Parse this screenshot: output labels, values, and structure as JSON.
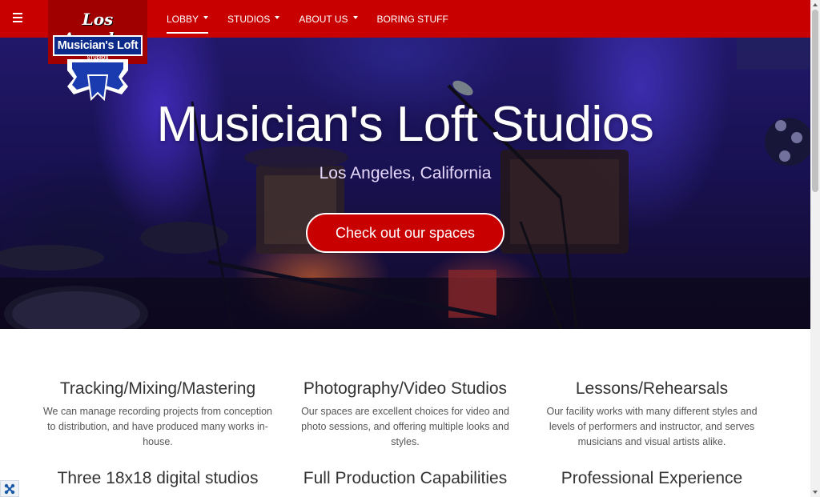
{
  "nav": {
    "menu_icon": "hamburger-icon",
    "items": [
      {
        "label": "LOBBY",
        "has_caret": true,
        "active": true
      },
      {
        "label": "STUDIOS",
        "has_caret": true,
        "active": false
      },
      {
        "label": "ABOUT US",
        "has_caret": true,
        "active": false
      },
      {
        "label": "BORING STUFF",
        "has_caret": false,
        "active": false
      }
    ]
  },
  "logo": {
    "top_text": "Los Angeles",
    "main_text": "Musician's Loft",
    "sub_text": "STUDIOS"
  },
  "hero": {
    "title": "Musician's Loft Studios",
    "subtitle": "Los Angeles, California",
    "button_label": "Check out our spaces"
  },
  "features": [
    {
      "title": "Tracking/Mixing/Mastering",
      "text": "We can manage recording projects from conception to distribution, and have produced many works in-house."
    },
    {
      "title": "Photography/Video Studios",
      "text": "Our spaces are excellent choices for video and photo sessions, and offering multiple looks and styles."
    },
    {
      "title": "Lessons/Rehearsals",
      "text": "Our facility works with many different styles and levels of performers and instructor, and serves musicians and visual artists alike."
    },
    {
      "title": "Three 18x18 digital studios",
      "text": ""
    },
    {
      "title": "Full Production Capabilities",
      "text": ""
    },
    {
      "title": "Professional Experience",
      "text": ""
    }
  ],
  "colors": {
    "brand_red": "#c80000",
    "logo_blue": "#0b2a8a",
    "hero_purple": "#2a1f80"
  },
  "badge_icon": "joomla-icon"
}
